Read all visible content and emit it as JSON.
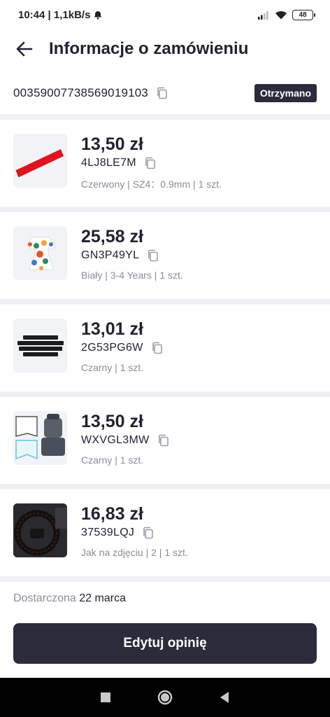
{
  "status_bar": {
    "time": "10:44 | 1,1kB/s",
    "battery": "48"
  },
  "header": {
    "title": "Informacje o zamówieniu"
  },
  "order": {
    "id": "00359007738569019103",
    "status": "Otrzymano"
  },
  "items": [
    {
      "price": "13,50 zł",
      "sku": "4LJ8LE7M",
      "variant": "Czerwony | SZ4：0.9mm | 1 szt.",
      "thumb_color": "#e0141f"
    },
    {
      "price": "25,58 zł",
      "sku": "GN3P49YL",
      "variant": "Biały | 3-4 Years | 1 szt.",
      "thumb_color": "#f4a23a"
    },
    {
      "price": "13,01 zł",
      "sku": "2G53PG6W",
      "variant": "Czarny | 1 szt.",
      "thumb_color": "#1b1c1f"
    },
    {
      "price": "13,50 zł",
      "sku": "WXVGL3MW",
      "variant": "Czarny | 1 szt.",
      "thumb_color": "#4a4f5c"
    },
    {
      "price": "16,83 zł",
      "sku": "37539LQJ",
      "variant": "Jak na zdjęciu | 2 | 1 szt.",
      "thumb_color": "#2a2a2e"
    }
  ],
  "delivery": {
    "label": "Dostarczona",
    "date": "22 marca"
  },
  "actions": {
    "edit_review": "Edytuj opinię"
  },
  "colors": {
    "accent_dark": "#2a2c3b",
    "separator": "#eef0f3",
    "muted_text": "#8a8d99"
  }
}
